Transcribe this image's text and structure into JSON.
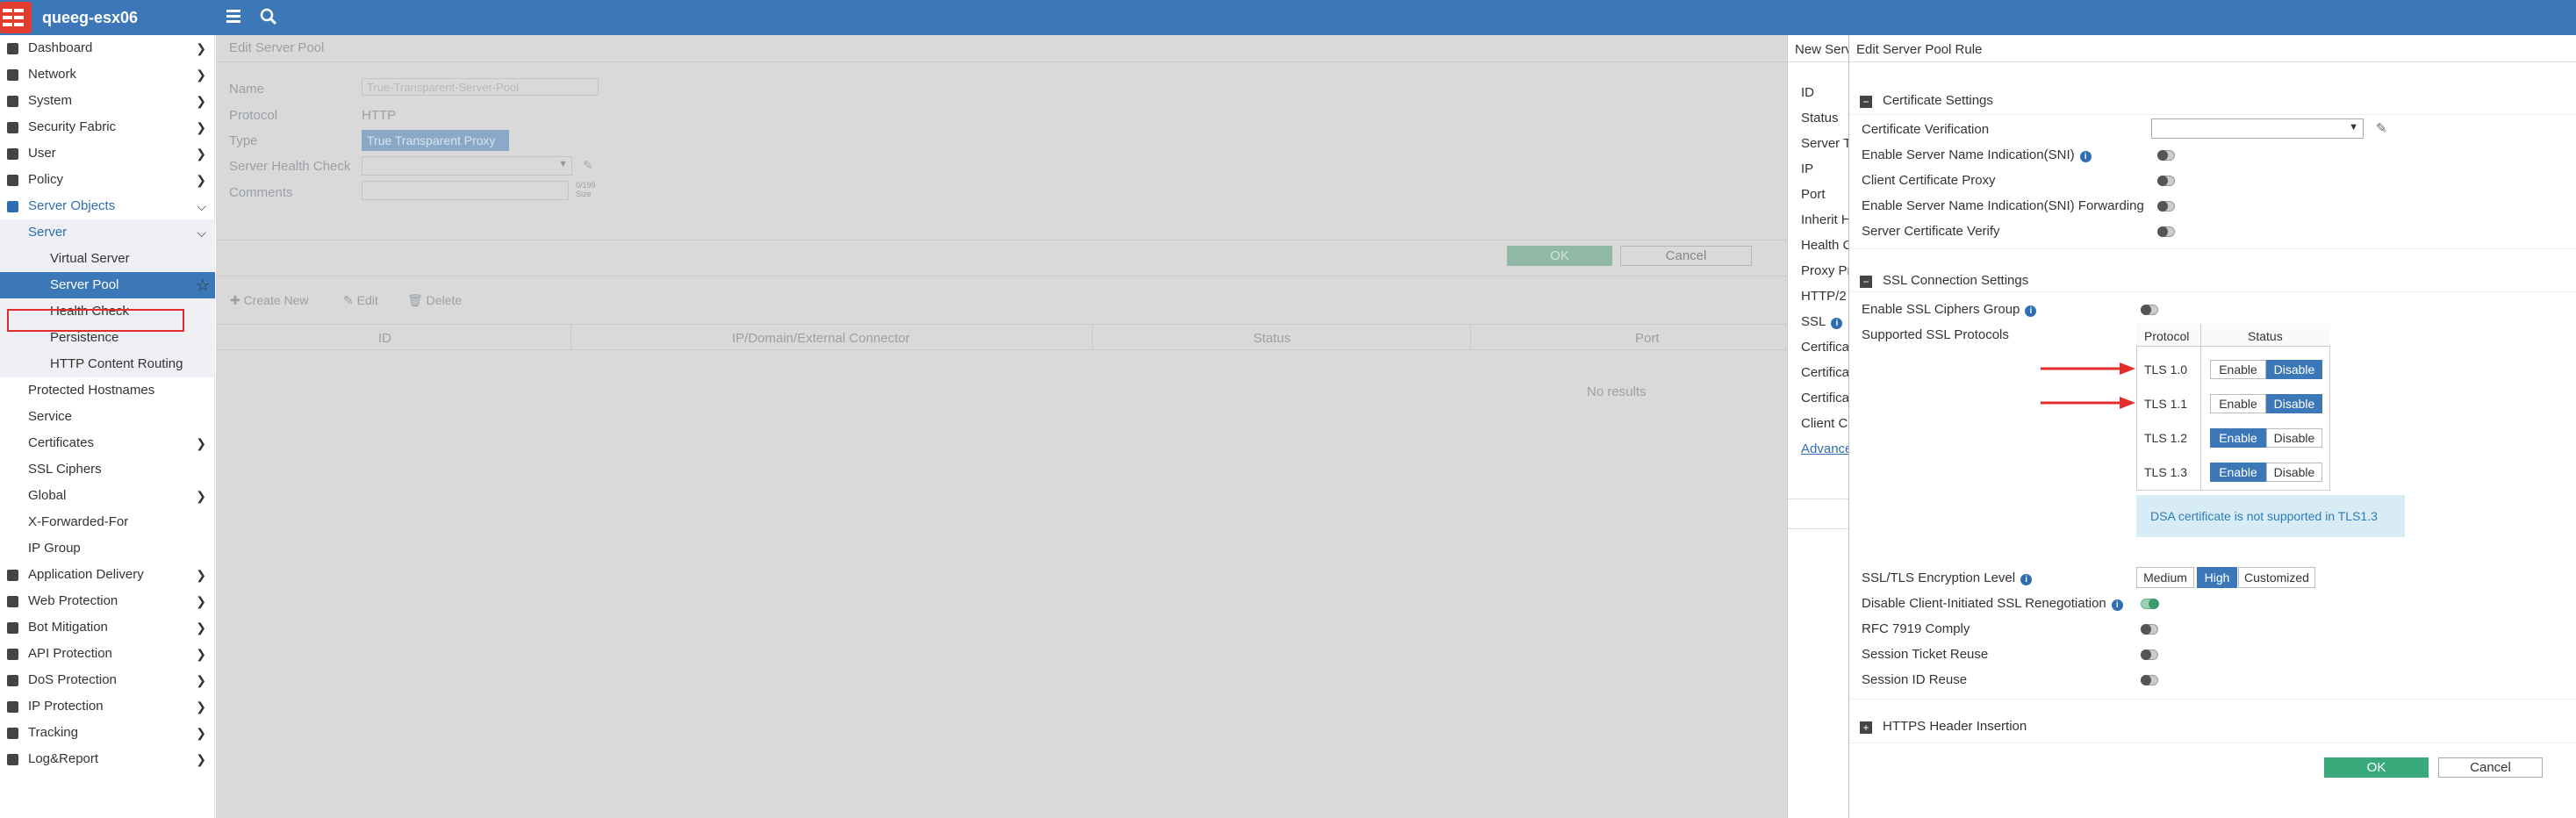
{
  "topbar": {
    "hostname": "queeg-esx06"
  },
  "sidebar": {
    "items": [
      {
        "label": "Dashboard"
      },
      {
        "label": "Network"
      },
      {
        "label": "System"
      },
      {
        "label": "Security Fabric"
      },
      {
        "label": "User"
      },
      {
        "label": "Policy"
      },
      {
        "label": "Server Objects"
      },
      {
        "label": "Server"
      },
      {
        "label": "Virtual Server"
      },
      {
        "label": "Server Pool"
      },
      {
        "label": "Health Check"
      },
      {
        "label": "Persistence"
      },
      {
        "label": "HTTP Content Routing"
      },
      {
        "label": "Protected Hostnames"
      },
      {
        "label": "Service"
      },
      {
        "label": "Certificates"
      },
      {
        "label": "SSL Ciphers"
      },
      {
        "label": "Global"
      },
      {
        "label": "X-Forwarded-For"
      },
      {
        "label": "IP Group"
      },
      {
        "label": "Application Delivery"
      },
      {
        "label": "Web Protection"
      },
      {
        "label": "Bot Mitigation"
      },
      {
        "label": "API Protection"
      },
      {
        "label": "DoS Protection"
      },
      {
        "label": "IP Protection"
      },
      {
        "label": "Tracking"
      },
      {
        "label": "Log&Report"
      }
    ]
  },
  "edit_pool": {
    "title": "Edit Server Pool",
    "name_label": "Name",
    "name_value": "True-Transparent-Server-Pool",
    "protocol_label": "Protocol",
    "protocol_value": "HTTP",
    "type_label": "Type",
    "type_value": "True Transparent Proxy",
    "health_label": "Server Health Check",
    "comments_label": "Comments",
    "comments_count": "0/199",
    "comments_unit": "Size",
    "ok": "OK",
    "cancel": "Cancel",
    "create_new": "Create New",
    "edit": "Edit",
    "delete": "Delete",
    "columns": [
      "ID",
      "IP/Domain/External Connector",
      "Status",
      "Port"
    ],
    "no_results": "No results"
  },
  "new_server": {
    "title": "New Serv",
    "labels": [
      "ID",
      "Status",
      "Server T",
      "IP",
      "Port",
      "Inherit H",
      "Health C",
      "Proxy Pr",
      "HTTP/2",
      "SSL",
      "Certifica",
      "Certifica",
      "Certifica",
      "Client C"
    ],
    "advanced": "Advance"
  },
  "rule": {
    "title": "Edit Server Pool Rule",
    "cert_section": "Certificate Settings",
    "cert_verification": "Certificate Verification",
    "sni": "Enable Server Name Indication(SNI)",
    "client_cert_proxy": "Client Certificate Proxy",
    "sni_forwarding": "Enable Server Name Indication(SNI) Forwarding",
    "server_cert_verify": "Server Certificate Verify",
    "ssl_section": "SSL Connection Settings",
    "ciphers_group": "Enable SSL Ciphers Group",
    "supported_protocols": "Supported SSL Protocols",
    "protocol_header": "Protocol",
    "status_header": "Status",
    "enable": "Enable",
    "disable": "Disable",
    "protocols": [
      {
        "name": "TLS 1.0",
        "state": "Disable"
      },
      {
        "name": "TLS 1.1",
        "state": "Disable"
      },
      {
        "name": "TLS 1.2",
        "state": "Enable"
      },
      {
        "name": "TLS 1.3",
        "state": "Enable"
      }
    ],
    "dsa_note": "DSA certificate is not supported in TLS1.3",
    "enc_level": "SSL/TLS Encryption Level",
    "levels": [
      "Medium",
      "High",
      "Customized"
    ],
    "selected_level": "High",
    "disable_reneg": "Disable Client-Initiated SSL Renegotiation",
    "rfc7919": "RFC 7919 Comply",
    "ticket_reuse": "Session Ticket Reuse",
    "id_reuse": "Session ID Reuse",
    "https_header": "HTTPS Header Insertion",
    "ok": "OK",
    "cancel": "Cancel"
  },
  "colors": {
    "topbar": "#3c78b8",
    "accent": "#3c78b8",
    "ok_green": "#3aaa7c",
    "highlight_red": "#e32d2d"
  }
}
